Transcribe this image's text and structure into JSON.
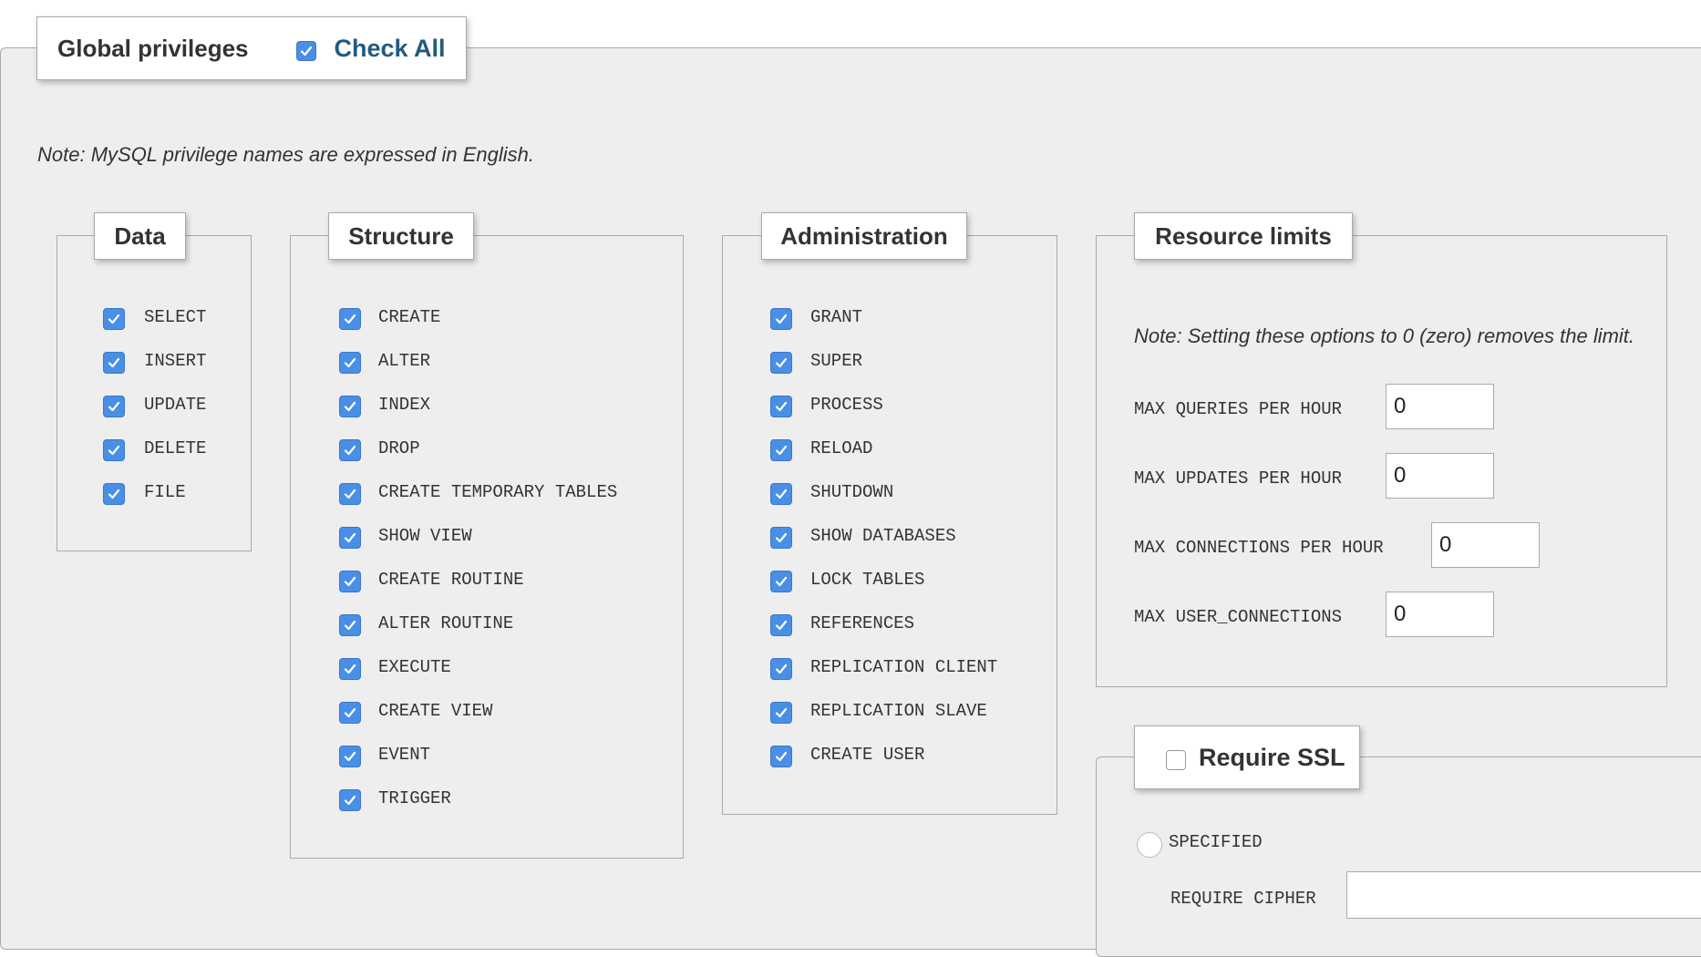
{
  "global": {
    "title": "Global privileges",
    "check_all_label": "Check All",
    "check_all_checked": true,
    "note": "Note: MySQL privilege names are expressed in English."
  },
  "data_group": {
    "title": "Data",
    "items": [
      {
        "label": "SELECT",
        "checked": true
      },
      {
        "label": "INSERT",
        "checked": true
      },
      {
        "label": "UPDATE",
        "checked": true
      },
      {
        "label": "DELETE",
        "checked": true
      },
      {
        "label": "FILE",
        "checked": true
      }
    ]
  },
  "structure_group": {
    "title": "Structure",
    "items": [
      {
        "label": "CREATE",
        "checked": true
      },
      {
        "label": "ALTER",
        "checked": true
      },
      {
        "label": "INDEX",
        "checked": true
      },
      {
        "label": "DROP",
        "checked": true
      },
      {
        "label": "CREATE TEMPORARY TABLES",
        "checked": true
      },
      {
        "label": "SHOW VIEW",
        "checked": true
      },
      {
        "label": "CREATE ROUTINE",
        "checked": true
      },
      {
        "label": "ALTER ROUTINE",
        "checked": true
      },
      {
        "label": "EXECUTE",
        "checked": true
      },
      {
        "label": "CREATE VIEW",
        "checked": true
      },
      {
        "label": "EVENT",
        "checked": true
      },
      {
        "label": "TRIGGER",
        "checked": true
      }
    ]
  },
  "admin_group": {
    "title": "Administration",
    "items": [
      {
        "label": "GRANT",
        "checked": true
      },
      {
        "label": "SUPER",
        "checked": true
      },
      {
        "label": "PROCESS",
        "checked": true
      },
      {
        "label": "RELOAD",
        "checked": true
      },
      {
        "label": "SHUTDOWN",
        "checked": true
      },
      {
        "label": "SHOW DATABASES",
        "checked": true
      },
      {
        "label": "LOCK TABLES",
        "checked": true
      },
      {
        "label": "REFERENCES",
        "checked": true
      },
      {
        "label": "REPLICATION CLIENT",
        "checked": true
      },
      {
        "label": "REPLICATION SLAVE",
        "checked": true
      },
      {
        "label": "CREATE USER",
        "checked": true
      }
    ]
  },
  "resource_limits": {
    "title": "Resource limits",
    "note": "Note: Setting these options to 0 (zero) removes the limit.",
    "fields": [
      {
        "label": "MAX QUERIES PER HOUR",
        "value": "0"
      },
      {
        "label": "MAX UPDATES PER HOUR",
        "value": "0"
      },
      {
        "label": "MAX CONNECTIONS PER HOUR",
        "value": "0"
      },
      {
        "label": "MAX USER_CONNECTIONS",
        "value": "0"
      }
    ]
  },
  "ssl": {
    "title": "Require SSL",
    "checked": false,
    "specified_label": "SPECIFIED",
    "require_cipher_label": "REQUIRE CIPHER",
    "require_cipher_value": ""
  },
  "colors": {
    "panel_bg": "#eeeeee",
    "border": "#aaaaaa",
    "checkbox_accent": "#4a8fe6",
    "link_blue": "#235a81"
  }
}
